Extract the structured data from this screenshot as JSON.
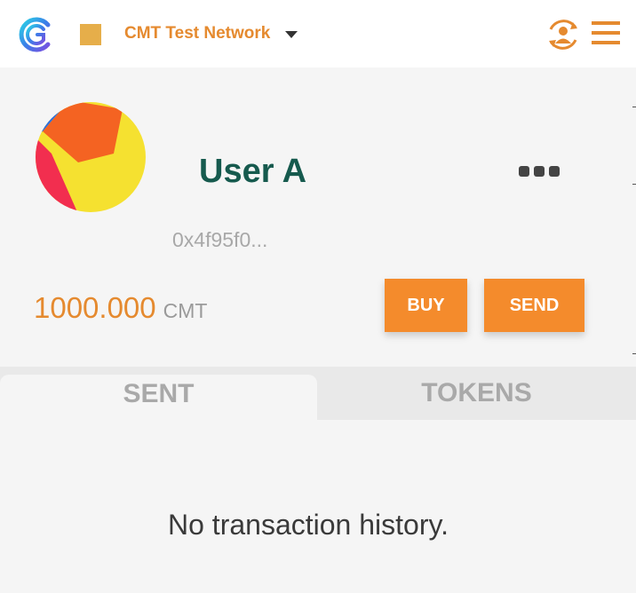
{
  "header": {
    "network_name": "CMT Test Network",
    "network_color": "#e6ae4a",
    "accent_color": "#e58a2f",
    "icons": [
      "cmt-logo-icon",
      "caret-down-icon",
      "account-switch-icon",
      "hamburger-menu-icon"
    ]
  },
  "account": {
    "name": "User A",
    "address": "0x4f95f0...",
    "balance": "1000.000",
    "currency": "CMT"
  },
  "actions": {
    "buy_label": "BUY",
    "send_label": "SEND"
  },
  "tabs": [
    {
      "label": "SENT",
      "active": true
    },
    {
      "label": "TOKENS",
      "active": false
    }
  ],
  "history": {
    "empty_message": "No transaction history."
  }
}
